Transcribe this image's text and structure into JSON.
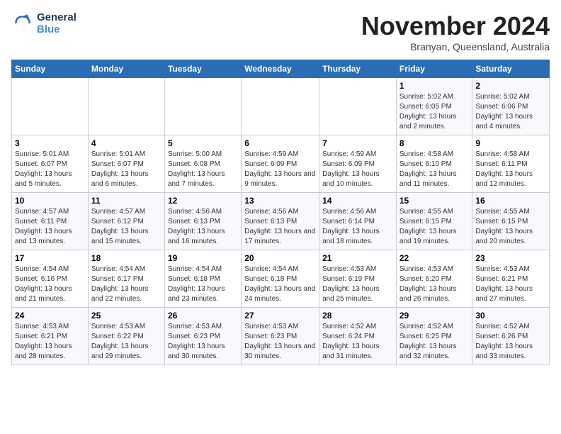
{
  "header": {
    "logo_line1": "General",
    "logo_line2": "Blue",
    "month": "November 2024",
    "location": "Branyan, Queensland, Australia"
  },
  "weekdays": [
    "Sunday",
    "Monday",
    "Tuesday",
    "Wednesday",
    "Thursday",
    "Friday",
    "Saturday"
  ],
  "weeks": [
    [
      {
        "day": "",
        "info": ""
      },
      {
        "day": "",
        "info": ""
      },
      {
        "day": "",
        "info": ""
      },
      {
        "day": "",
        "info": ""
      },
      {
        "day": "",
        "info": ""
      },
      {
        "day": "1",
        "info": "Sunrise: 5:02 AM\nSunset: 6:05 PM\nDaylight: 13 hours and 2 minutes."
      },
      {
        "day": "2",
        "info": "Sunrise: 5:02 AM\nSunset: 6:06 PM\nDaylight: 13 hours and 4 minutes."
      }
    ],
    [
      {
        "day": "3",
        "info": "Sunrise: 5:01 AM\nSunset: 6:07 PM\nDaylight: 13 hours and 5 minutes."
      },
      {
        "day": "4",
        "info": "Sunrise: 5:01 AM\nSunset: 6:07 PM\nDaylight: 13 hours and 6 minutes."
      },
      {
        "day": "5",
        "info": "Sunrise: 5:00 AM\nSunset: 6:08 PM\nDaylight: 13 hours and 7 minutes."
      },
      {
        "day": "6",
        "info": "Sunrise: 4:59 AM\nSunset: 6:09 PM\nDaylight: 13 hours and 9 minutes."
      },
      {
        "day": "7",
        "info": "Sunrise: 4:59 AM\nSunset: 6:09 PM\nDaylight: 13 hours and 10 minutes."
      },
      {
        "day": "8",
        "info": "Sunrise: 4:58 AM\nSunset: 6:10 PM\nDaylight: 13 hours and 11 minutes."
      },
      {
        "day": "9",
        "info": "Sunrise: 4:58 AM\nSunset: 6:11 PM\nDaylight: 13 hours and 12 minutes."
      }
    ],
    [
      {
        "day": "10",
        "info": "Sunrise: 4:57 AM\nSunset: 6:11 PM\nDaylight: 13 hours and 13 minutes."
      },
      {
        "day": "11",
        "info": "Sunrise: 4:57 AM\nSunset: 6:12 PM\nDaylight: 13 hours and 15 minutes."
      },
      {
        "day": "12",
        "info": "Sunrise: 4:56 AM\nSunset: 6:13 PM\nDaylight: 13 hours and 16 minutes."
      },
      {
        "day": "13",
        "info": "Sunrise: 4:56 AM\nSunset: 6:13 PM\nDaylight: 13 hours and 17 minutes."
      },
      {
        "day": "14",
        "info": "Sunrise: 4:56 AM\nSunset: 6:14 PM\nDaylight: 13 hours and 18 minutes."
      },
      {
        "day": "15",
        "info": "Sunrise: 4:55 AM\nSunset: 6:15 PM\nDaylight: 13 hours and 19 minutes."
      },
      {
        "day": "16",
        "info": "Sunrise: 4:55 AM\nSunset: 6:15 PM\nDaylight: 13 hours and 20 minutes."
      }
    ],
    [
      {
        "day": "17",
        "info": "Sunrise: 4:54 AM\nSunset: 6:16 PM\nDaylight: 13 hours and 21 minutes."
      },
      {
        "day": "18",
        "info": "Sunrise: 4:54 AM\nSunset: 6:17 PM\nDaylight: 13 hours and 22 minutes."
      },
      {
        "day": "19",
        "info": "Sunrise: 4:54 AM\nSunset: 6:18 PM\nDaylight: 13 hours and 23 minutes."
      },
      {
        "day": "20",
        "info": "Sunrise: 4:54 AM\nSunset: 6:18 PM\nDaylight: 13 hours and 24 minutes."
      },
      {
        "day": "21",
        "info": "Sunrise: 4:53 AM\nSunset: 6:19 PM\nDaylight: 13 hours and 25 minutes."
      },
      {
        "day": "22",
        "info": "Sunrise: 4:53 AM\nSunset: 6:20 PM\nDaylight: 13 hours and 26 minutes."
      },
      {
        "day": "23",
        "info": "Sunrise: 4:53 AM\nSunset: 6:21 PM\nDaylight: 13 hours and 27 minutes."
      }
    ],
    [
      {
        "day": "24",
        "info": "Sunrise: 4:53 AM\nSunset: 6:21 PM\nDaylight: 13 hours and 28 minutes."
      },
      {
        "day": "25",
        "info": "Sunrise: 4:53 AM\nSunset: 6:22 PM\nDaylight: 13 hours and 29 minutes."
      },
      {
        "day": "26",
        "info": "Sunrise: 4:53 AM\nSunset: 6:23 PM\nDaylight: 13 hours and 30 minutes."
      },
      {
        "day": "27",
        "info": "Sunrise: 4:53 AM\nSunset: 6:23 PM\nDaylight: 13 hours and 30 minutes."
      },
      {
        "day": "28",
        "info": "Sunrise: 4:52 AM\nSunset: 6:24 PM\nDaylight: 13 hours and 31 minutes."
      },
      {
        "day": "29",
        "info": "Sunrise: 4:52 AM\nSunset: 6:25 PM\nDaylight: 13 hours and 32 minutes."
      },
      {
        "day": "30",
        "info": "Sunrise: 4:52 AM\nSunset: 6:26 PM\nDaylight: 13 hours and 33 minutes."
      }
    ]
  ]
}
